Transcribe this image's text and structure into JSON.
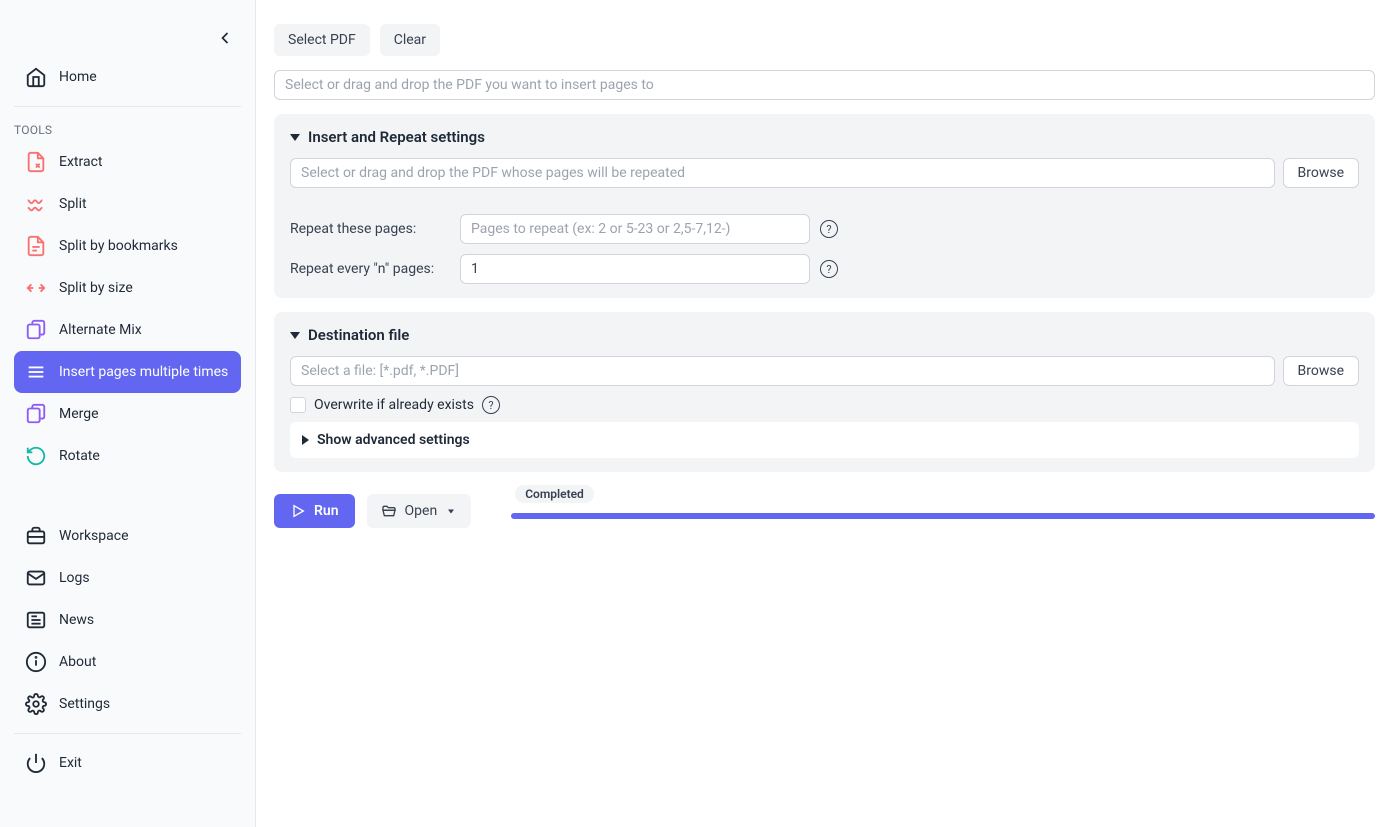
{
  "sidebar": {
    "home": "Home",
    "tools_label": "TOOLS",
    "items": [
      {
        "label": "Extract"
      },
      {
        "label": "Split"
      },
      {
        "label": "Split by bookmarks"
      },
      {
        "label": "Split by size"
      },
      {
        "label": "Alternate Mix"
      },
      {
        "label": "Insert pages multiple times"
      },
      {
        "label": "Merge"
      },
      {
        "label": "Rotate"
      }
    ],
    "bottom": [
      {
        "label": "Workspace"
      },
      {
        "label": "Logs"
      },
      {
        "label": "News"
      },
      {
        "label": "About"
      },
      {
        "label": "Settings"
      },
      {
        "label": "Exit"
      }
    ]
  },
  "toolbar": {
    "select_pdf": "Select PDF",
    "clear": "Clear"
  },
  "main_input": {
    "placeholder": "Select or drag and drop the PDF you want to insert pages to"
  },
  "insert_panel": {
    "title": "Insert and Repeat settings",
    "source_placeholder": "Select or drag and drop the PDF whose pages will be repeated",
    "browse": "Browse",
    "repeat_pages_label": "Repeat these pages:",
    "repeat_pages_placeholder": "Pages to repeat (ex: 2 or 5-23 or 2,5-7,12-)",
    "repeat_every_label": "Repeat every \"n\" pages:",
    "repeat_every_value": "1"
  },
  "dest_panel": {
    "title": "Destination file",
    "placeholder": "Select a file: [*.pdf, *.PDF]",
    "browse": "Browse",
    "overwrite_label": "Overwrite if already exists",
    "advanced_label": "Show advanced settings"
  },
  "actions": {
    "run": "Run",
    "open": "Open",
    "status": "Completed"
  }
}
